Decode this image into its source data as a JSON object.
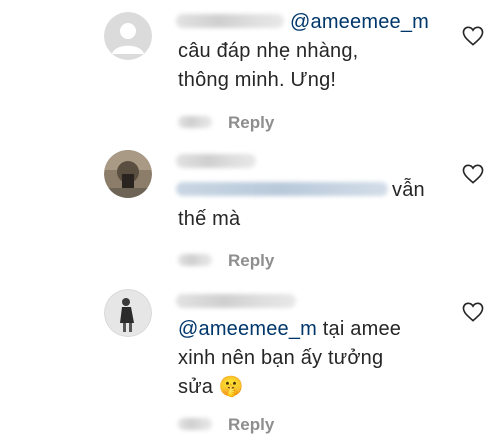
{
  "comments": [
    {
      "mention": "@ameemee_m",
      "text_lines": [
        "câu đáp nhẹ nhàng,",
        "thông minh. Ưng!"
      ],
      "reply_label": "Reply",
      "avatar": "default-avatar-icon",
      "like_icon": "heart-outline-icon"
    },
    {
      "text_lines": [
        "vẫn",
        "thế mà"
      ],
      "reply_label": "Reply",
      "avatar": "user-photo-avatar",
      "like_icon": "heart-outline-icon"
    },
    {
      "mention": "@ameemee_m",
      "text_after_mention": " tại amee",
      "text_lines": [
        "xinh nên bạn ấy tưởng",
        "sửa"
      ],
      "emoji": "🤫",
      "reply_label": "Reply",
      "avatar": "user-photo-avatar",
      "like_icon": "heart-outline-icon"
    }
  ],
  "colors": {
    "text": "#262626",
    "mention": "#00376b",
    "meta": "#8e8e8e",
    "background": "#ffffff"
  }
}
